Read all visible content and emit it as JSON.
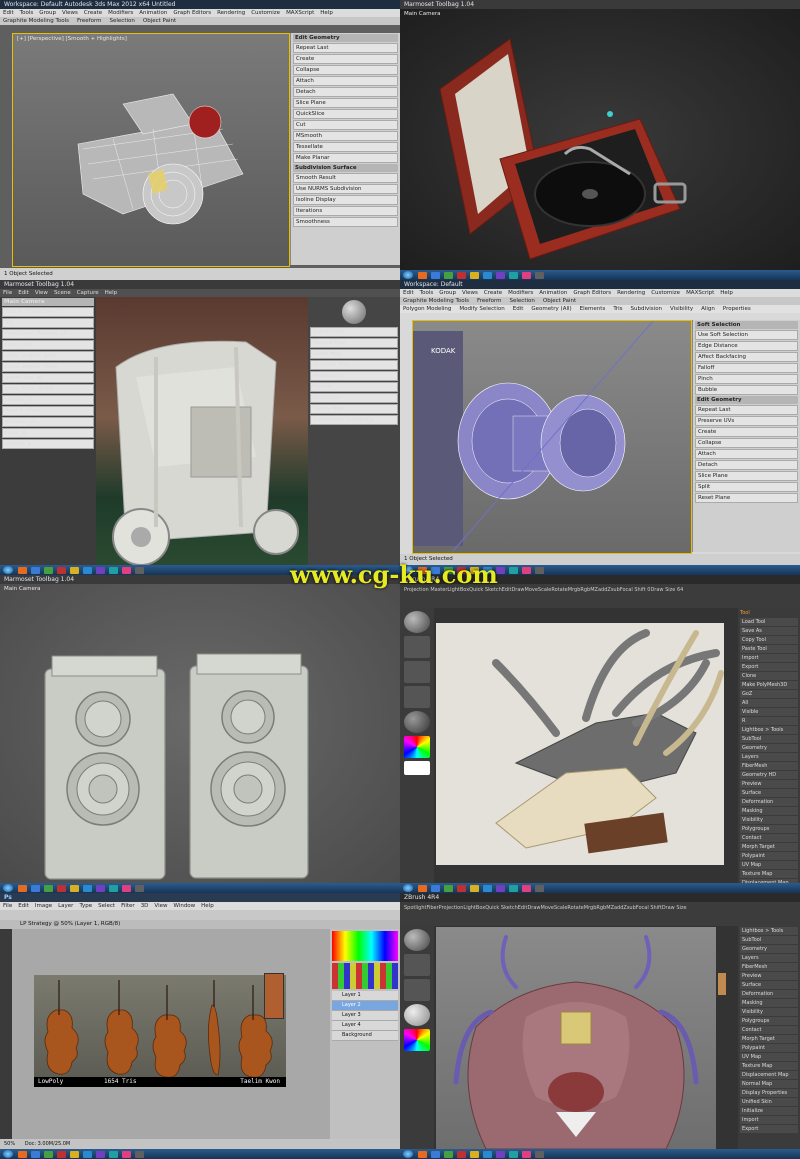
{
  "watermark": "www.cg-ku.com",
  "panels": {
    "max_camera": {
      "title": "Workspace: Default    Autodesk 3ds Max 2012 x64    Untitled",
      "menu": [
        "Edit",
        "Tools",
        "Group",
        "Views",
        "Create",
        "Modifiers",
        "Animation",
        "Graph Editors",
        "Rendering",
        "Customize",
        "MAXScript",
        "Help"
      ],
      "ribbon": [
        "Graphite Modeling Tools",
        "Freeform",
        "Selection",
        "Object Paint"
      ],
      "viewport_label": "[+] [Perspective] [Smooth + Highlights]",
      "side_items": [
        "Edit Geometry",
        "Repeat Last",
        "Create",
        "Collapse",
        "Attach",
        "Detach",
        "Slice Plane",
        "QuickSlice",
        "Cut",
        "MSmooth",
        "Tessellate",
        "Make Planar",
        "Subdivision Surface",
        "Smooth Result",
        "Use NURMS Subdivision",
        "Isoline Display",
        "Iterations",
        "Smoothness"
      ],
      "status": "1 Object Selected"
    },
    "record_player": {
      "title": "Marmoset Toolbag 1.04",
      "viewport_label": "Main Camera"
    },
    "rickshaw": {
      "title": "Marmoset Toolbag 1.04",
      "menu": [
        "File",
        "Edit",
        "View",
        "Scene",
        "Capture",
        "Help"
      ],
      "tree_header": "Main Camera",
      "tree_items": [
        "Main Camera",
        "Tuktuk_SuperCam_LP",
        "Sky",
        "FrontPanel_Window_LP",
        "cross_mid",
        "cross_engine_gear",
        "cross_engine_main",
        "gener_box_lp",
        "cross_front_brake",
        "chassis_lp",
        "floor_a_cross",
        "exhaust_LP",
        "tyres_lp",
        "chassis_b"
      ],
      "material_items": [
        "Subdivision",
        "Normal Map",
        "Gloss Map",
        "Specular Map",
        "Reflectivity",
        "Fresnel",
        "Occlusion",
        "Cavity Map",
        "Subsurface Scattering"
      ]
    },
    "max_lens": {
      "title": "Workspace: Default",
      "menu": [
        "Edit",
        "Tools",
        "Group",
        "Views",
        "Create",
        "Modifiers",
        "Animation",
        "Graph Editors",
        "Rendering",
        "Customize",
        "MAXScript",
        "Help"
      ],
      "ribbon": [
        "Graphite Modeling Tools",
        "Freeform",
        "Selection",
        "Object Paint"
      ],
      "ribbon2": [
        "Polygon Modeling",
        "Modify Selection",
        "Edit",
        "Geometry (All)",
        "Elements",
        "Tris",
        "Subdivision",
        "Visibility",
        "Align",
        "Properties"
      ],
      "side_items": [
        "Soft Selection",
        "Use Soft Selection",
        "Edge Distance",
        "Affect Backfacing",
        "Falloff",
        "Pinch",
        "Bubble",
        "Edit Geometry",
        "Repeat Last",
        "Preserve UVs",
        "Create",
        "Collapse",
        "Attach",
        "Detach",
        "Slice Plane",
        "Split",
        "Reset Plane"
      ],
      "status": "1 Object Selected",
      "brand": "KODAK"
    },
    "twin_lens": {
      "title": "Marmoset Toolbag 1.04",
      "viewport_label": "Main Camera"
    },
    "skull": {
      "title": "ZBrush 4R4",
      "top_items": [
        "Projection Master",
        "LightBox",
        "Quick Sketch",
        "Edit",
        "Draw",
        "Move",
        "Scale",
        "Rotate",
        "Mrgb",
        "Rgb",
        "M",
        "Zadd",
        "Zsub",
        "Focal Shift 0",
        "Draw Size 64"
      ],
      "side_header": "Tool",
      "side_items": [
        "Load Tool",
        "Save As",
        "Copy Tool",
        "Paste Tool",
        "Import",
        "Export",
        "Clone",
        "Make PolyMesh3D",
        "GoZ",
        "All",
        "Visible",
        "R",
        "Lightbox > Tools",
        "SubTool",
        "Geometry",
        "Layers",
        "FiberMesh",
        "Geometry HD",
        "Preview",
        "Surface",
        "Deformation",
        "Masking",
        "Visibility",
        "Polygroups",
        "Contact",
        "Morph Target",
        "Polypaint",
        "UV Map",
        "Texture Map",
        "Displacement Map",
        "Normal Map",
        "Vector Displacement Map",
        "Display Properties",
        "Unified Skin",
        "Import",
        "Export"
      ]
    },
    "violins": {
      "title": "Ps",
      "menu": [
        "File",
        "Edit",
        "Image",
        "Layer",
        "Type",
        "Select",
        "Filter",
        "3D",
        "View",
        "Window",
        "Help"
      ],
      "doc_tab": "LP Strategy @ 50% (Layer 1, RGB/8)",
      "layers": [
        "Layer 1",
        "Layer 2",
        "Layer 3",
        "Layer 4",
        "Background"
      ],
      "caption_left": "LowPoly",
      "caption_mid": "1654 Tris",
      "caption_right": "Taelim Kwon",
      "caption_url": "http://www.taelimkwon.com",
      "status": "Doc: 3.00M/25.0M",
      "zoom": "50%"
    },
    "creature": {
      "title": "ZBrush 4R4",
      "top_items": [
        "Spotlight",
        "Fiber",
        "Projection",
        "LightBox",
        "Quick Sketch",
        "Edit",
        "Draw",
        "Move",
        "Scale",
        "Rotate",
        "Mrgb",
        "Rgb",
        "M",
        "Zadd",
        "Zsub",
        "Focal Shift",
        "Draw Size"
      ],
      "side_items": [
        "Lightbox > Tools",
        "SubTool",
        "Geometry",
        "Layers",
        "FiberMesh",
        "Preview",
        "Surface",
        "Deformation",
        "Masking",
        "Visibility",
        "Polygroups",
        "Contact",
        "Morph Target",
        "Polypaint",
        "UV Map",
        "Texture Map",
        "Displacement Map",
        "Normal Map",
        "Display Properties",
        "Unified Skin",
        "Initialize",
        "Import",
        "Export"
      ]
    }
  },
  "taskbar_colors": [
    "#e86a1f",
    "#3a7bd5",
    "#44a040",
    "#c03030",
    "#d8b020",
    "#2a8ad0",
    "#7040c0",
    "#20a0a0",
    "#e04080",
    "#606060"
  ]
}
